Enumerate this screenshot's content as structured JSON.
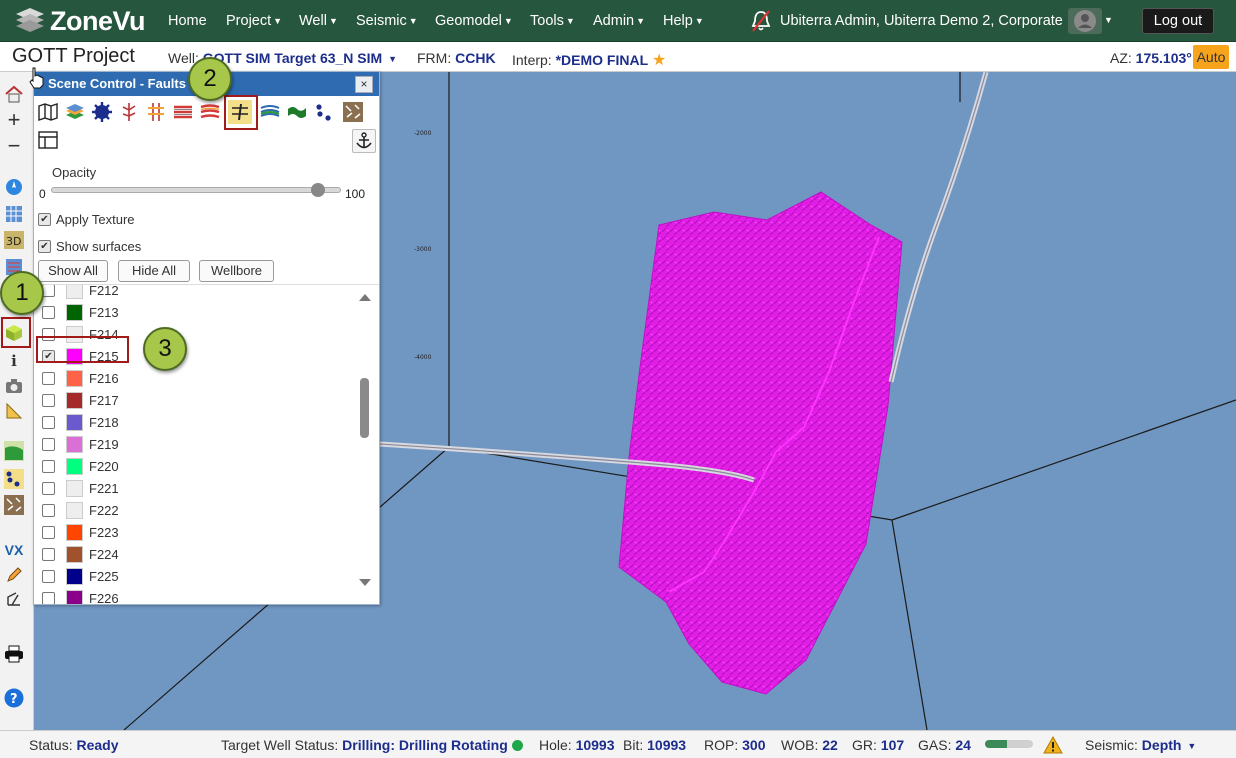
{
  "nav": {
    "logo": "ZoneVu",
    "items": [
      {
        "label": "Home",
        "has_caret": false
      },
      {
        "label": "Project",
        "has_caret": true
      },
      {
        "label": "Well",
        "has_caret": true
      },
      {
        "label": "Seismic",
        "has_caret": true
      },
      {
        "label": "Geomodel",
        "has_caret": true
      },
      {
        "label": "Tools",
        "has_caret": true
      },
      {
        "label": "Admin",
        "has_caret": true
      },
      {
        "label": "Help",
        "has_caret": true
      }
    ],
    "user": "Ubiterra Admin, Ubiterra Demo 2, Corporate",
    "logout": "Log out"
  },
  "header": {
    "project": "GOTT Project",
    "well_label": "Well:",
    "well_value": "GOTT SIM Target 63_N SIM",
    "frm_label": "FRM:",
    "frm_value": "CCHK",
    "interp_label": "Interp:",
    "interp_value": "*DEMO FINAL",
    "az_label": "AZ:",
    "az_value": "175.103°",
    "auto": "Auto"
  },
  "panel": {
    "title": "Scene Control - Faults",
    "close": "×",
    "opacity_label": "Opacity",
    "opacity_min": "0",
    "opacity_max": "100",
    "opacity_value": 0.92,
    "apply_texture": "Apply Texture",
    "show_surfaces": "Show surfaces",
    "show_all": "Show All",
    "hide_all": "Hide All",
    "wellbore": "Wellbore",
    "faults": [
      {
        "name": "F212",
        "color": "#eeeeee",
        "checked": false
      },
      {
        "name": "F213",
        "color": "#006400",
        "checked": false
      },
      {
        "name": "F214",
        "color": "#eeeeee",
        "checked": false
      },
      {
        "name": "F215",
        "color": "#ff00ff",
        "checked": true
      },
      {
        "name": "F216",
        "color": "#ff6347",
        "checked": false
      },
      {
        "name": "F217",
        "color": "#a52a2a",
        "checked": false
      },
      {
        "name": "F218",
        "color": "#6a5acd",
        "checked": false
      },
      {
        "name": "F219",
        "color": "#da70d6",
        "checked": false
      },
      {
        "name": "F220",
        "color": "#00ff7f",
        "checked": false
      },
      {
        "name": "F221",
        "color": "#eeeeee",
        "checked": false
      },
      {
        "name": "F222",
        "color": "#eeeeee",
        "checked": false
      },
      {
        "name": "F223",
        "color": "#ff4500",
        "checked": false
      },
      {
        "name": "F224",
        "color": "#a0522d",
        "checked": false
      },
      {
        "name": "F225",
        "color": "#00008b",
        "checked": false
      },
      {
        "name": "F226",
        "color": "#8b008b",
        "checked": false
      }
    ]
  },
  "view": {
    "depth_labels": [
      "-2000",
      "-3000",
      "-4000"
    ],
    "fault_color": "#e21ee6"
  },
  "callouts": [
    "1",
    "2",
    "3"
  ],
  "status": {
    "status_label": "Status:",
    "status_value": "Ready",
    "target_label": "Target Well Status:",
    "target_value": "Drilling: Drilling Rotating",
    "hole_label": "Hole:",
    "hole_value": "10993",
    "bit_label": "Bit:",
    "bit_value": "10993",
    "rop_label": "ROP:",
    "rop_value": "300",
    "wob_label": "WOB:",
    "wob_value": "22",
    "gr_label": "GR:",
    "gr_value": "107",
    "gas_label": "GAS:",
    "gas_value": "24",
    "gas_level": 0.45,
    "seismic_label": "Seismic:",
    "seismic_value": "Depth"
  }
}
